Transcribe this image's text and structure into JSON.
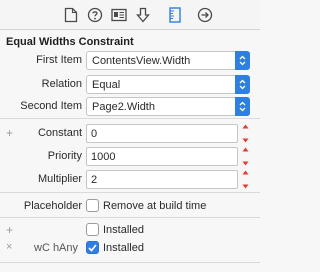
{
  "toolbar": {
    "icons": [
      "file-inspector-icon",
      "quick-help-icon",
      "identity-inspector-icon",
      "attributes-inspector-icon",
      "size-inspector-icon",
      "connections-inspector-icon"
    ],
    "selected": "size-inspector-icon"
  },
  "section": {
    "title": "Equal Widths Constraint"
  },
  "first_item": {
    "label": "First Item",
    "value": "ContentsView.Width"
  },
  "relation": {
    "label": "Relation",
    "value": "Equal"
  },
  "second_item": {
    "label": "Second Item",
    "value": "Page2.Width"
  },
  "constant": {
    "label": "Constant",
    "value": "0"
  },
  "priority": {
    "label": "Priority",
    "value": "1000"
  },
  "multiplier": {
    "label": "Multiplier",
    "value": "2"
  },
  "placeholder": {
    "label": "Placeholder",
    "checkbox_label": "Remove at build time",
    "checked": false
  },
  "installed": {
    "checkbox_label": "Installed",
    "checked": false
  },
  "installed_sizeclass": {
    "size_class": "wC hAny",
    "checkbox_label": "Installed",
    "checked": true
  },
  "colors": {
    "accent": "#2f7fe3",
    "selected_tab": "#2f7fe3",
    "text": "#2a2a2a",
    "background": "#f7f7f7"
  }
}
